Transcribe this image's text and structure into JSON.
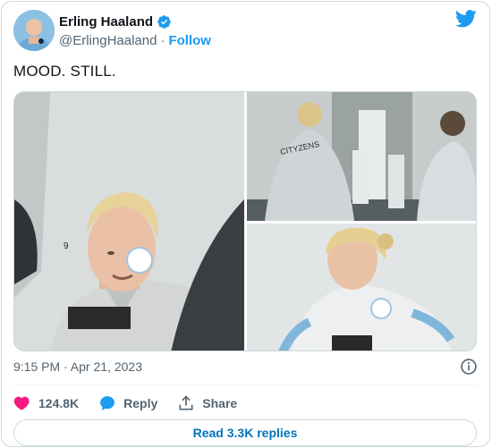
{
  "author": {
    "display_name": "Erling Haaland",
    "handle": "@ErlingHaaland",
    "separator": "·",
    "follow_label": "Follow"
  },
  "tweet": {
    "text": "MOOD. STILL.",
    "timestamp": "9:15 PM · Apr 21, 2023"
  },
  "media": {
    "photos": [
      {
        "kit_text": "9"
      },
      {
        "kit_text": "CITYZENS"
      },
      {
        "kit_text": ""
      }
    ]
  },
  "actions": {
    "likes": "124.8K",
    "reply_label": "Reply",
    "share_label": "Share"
  },
  "replies_button": "Read 3.3K replies",
  "colors": {
    "accent": "#1d9bf0",
    "like": "#f91880",
    "reply_link": "#0074ba",
    "secondary_text": "#536471"
  },
  "icons": {
    "verified": "verified-badge-icon",
    "logo": "twitter-bird-icon",
    "info": "info-icon",
    "like": "heart-icon",
    "reply": "speech-bubble-icon",
    "share": "share-upload-icon"
  }
}
